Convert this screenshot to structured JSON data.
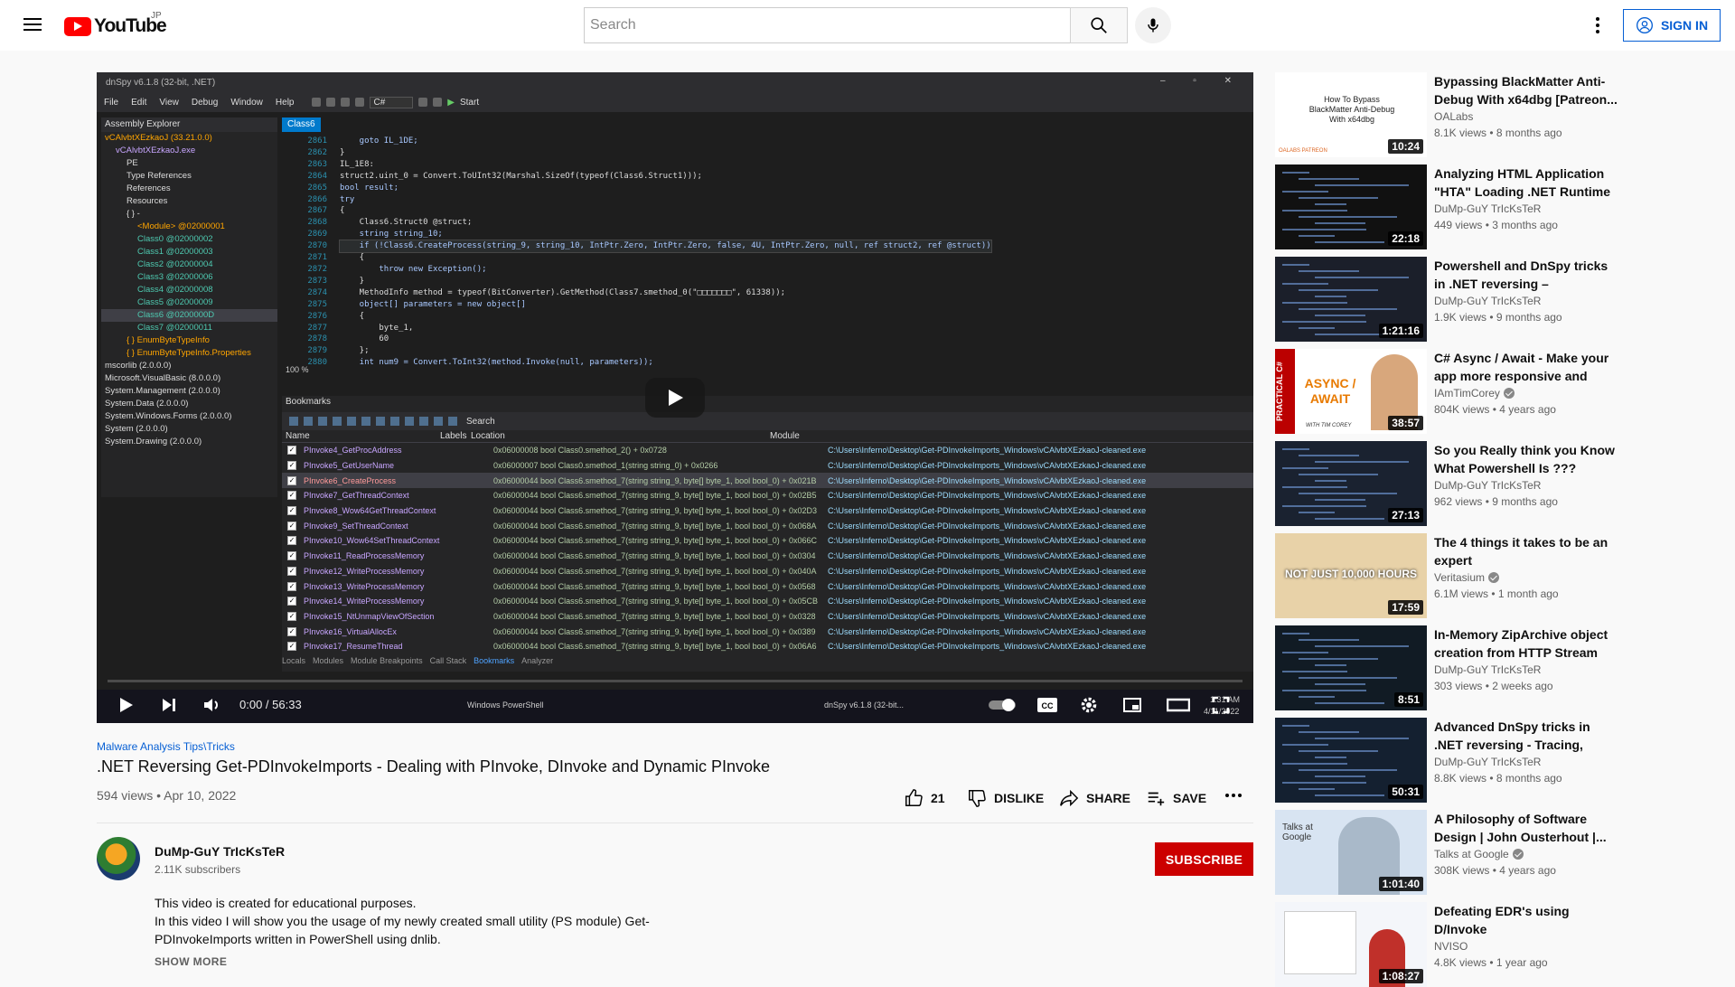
{
  "header": {
    "logo_text": "YouTube",
    "country_code": "JP",
    "search_placeholder": "Search",
    "signin_label": "SIGN IN"
  },
  "player": {
    "dnspy": {
      "window_title": "dnSpy v6.1.8 (32-bit, .NET)",
      "menu": [
        "File",
        "Edit",
        "View",
        "Debug",
        "Window",
        "Help"
      ],
      "language": "C#",
      "start_label": "Start",
      "assembly_explorer_title": "Assembly Explorer",
      "tree": [
        "vCAlvbtXEzkaoJ (33.21.0.0)",
        "vCAlvbtXEzkaoJ.exe",
        "PE",
        "Type References",
        "References",
        "Resources",
        "{ } -",
        "<Module> @02000001",
        "Class0 @02000002",
        "Class1 @02000003",
        "Class2 @02000004",
        "Class3 @02000006",
        "Class4 @02000008",
        "Class5 @02000009",
        "Class6 @0200000D",
        "Class7 @02000011",
        "{ } EnumByteTypeInfo",
        "{ } EnumByteTypeInfo.Properties",
        "mscorlib (2.0.0.0)",
        "Microsoft.VisualBasic (8.0.0.0)",
        "System.Management (2.0.0.0)",
        "System.Data (2.0.0.0)",
        "System.Windows.Forms (2.0.0.0)",
        "System (2.0.0.0)",
        "System.Drawing (2.0.0.0)"
      ],
      "code_tab": "Class6",
      "line_numbers": [
        "2861",
        "2862",
        "2863",
        "2864",
        "2865",
        "2866",
        "2867",
        "2868",
        "2869",
        "2870",
        "2871",
        "2872",
        "2873",
        "2874",
        "2875",
        "2876",
        "2877",
        "2878",
        "2879",
        "2880"
      ],
      "code_lines": [
        "    goto IL_1DE;",
        "}",
        "IL_1E8:",
        "struct2.uint_0 = Convert.ToUInt32(Marshal.SizeOf(typeof(Class6.Struct1)));",
        "bool result;",
        "try",
        "{",
        "    Class6.Struct0 @struct;",
        "    string string_10;",
        "    if (!Class6.CreateProcess(string_9, string_10, IntPtr.Zero, IntPtr.Zero, false, 4U, IntPtr.Zero, null, ref struct2, ref @struct))",
        "    {",
        "        throw new Exception();",
        "    }",
        "    MethodInfo method = typeof(BitConverter).GetMethod(Class7.smethod_0(\"□□□□□□□\", 61338));",
        "    object[] parameters = new object[]",
        "    {",
        "        byte_1,",
        "        60",
        "    };",
        "    int num9 = Convert.ToInt32(method.Invoke(null, parameters));"
      ],
      "zoom": "100 %",
      "bookmarks_title": "Bookmarks",
      "bookmarks_search": "Search",
      "bookmark_columns": [
        "Name",
        "Labels",
        "Location",
        "Module"
      ],
      "bookmarks": [
        {
          "name": "PInvoke4_GetProcAddress",
          "location": "0x06000008 bool Class0.smethod_2() + 0x0728"
        },
        {
          "name": "PInvoke5_GetUserName",
          "location": "0x06000007 bool Class0.smethod_1(string string_0) + 0x0266"
        },
        {
          "name": "PInvoke6_CreateProcess",
          "location": "0x06000044 bool Class6.smethod_7(string string_9, byte[] byte_1, bool bool_0) + 0x021B"
        },
        {
          "name": "PInvoke7_GetThreadContext",
          "location": "0x06000044 bool Class6.smethod_7(string string_9, byte[] byte_1, bool bool_0) + 0x02B5"
        },
        {
          "name": "PInvoke8_Wow64GetThreadContext",
          "location": "0x06000044 bool Class6.smethod_7(string string_9, byte[] byte_1, bool bool_0) + 0x02D3"
        },
        {
          "name": "PInvoke9_SetThreadContext",
          "location": "0x06000044 bool Class6.smethod_7(string string_9, byte[] byte_1, bool bool_0) + 0x068A"
        },
        {
          "name": "PInvoke10_Wow64SetThreadContext",
          "location": "0x06000044 bool Class6.smethod_7(string string_9, byte[] byte_1, bool bool_0) + 0x066C"
        },
        {
          "name": "PInvoke11_ReadProcessMemory",
          "location": "0x06000044 bool Class6.smethod_7(string string_9, byte[] byte_1, bool bool_0) + 0x0304"
        },
        {
          "name": "PInvoke12_WriteProcessMemory",
          "location": "0x06000044 bool Class6.smethod_7(string string_9, byte[] byte_1, bool bool_0) + 0x040A"
        },
        {
          "name": "PInvoke13_WriteProcessMemory",
          "location": "0x06000044 bool Class6.smethod_7(string string_9, byte[] byte_1, bool bool_0) + 0x0568"
        },
        {
          "name": "PInvoke14_WriteProcessMemory",
          "location": "0x06000044 bool Class6.smethod_7(string string_9, byte[] byte_1, bool bool_0) + 0x05CB"
        },
        {
          "name": "PInvoke15_NtUnmapViewOfSection",
          "location": "0x06000044 bool Class6.smethod_7(string string_9, byte[] byte_1, bool bool_0) + 0x0328"
        },
        {
          "name": "PInvoke16_VirtualAllocEx",
          "location": "0x06000044 bool Class6.smethod_7(string string_9, byte[] byte_1, bool bool_0) + 0x0389"
        },
        {
          "name": "PInvoke17_ResumeThread",
          "location": "0x06000044 bool Class6.smethod_7(string string_9, byte[] byte_1, bool bool_0) + 0x06A6"
        }
      ],
      "module_path": "C:\\Users\\Inferno\\Desktop\\Get-PDInvokeImports_Windows\\vCAlvbtXEzkaoJ-cleaned.exe",
      "bottom_tabs": [
        "Locals",
        "Modules",
        "Module Breakpoints",
        "Call Stack",
        "Bookmarks",
        "Analyzer"
      ],
      "taskbar_items": [
        "Windows PowerShell",
        "dnSpy v6.1.8 (32-bit..."
      ],
      "taskbar_time": "1:31 AM",
      "taskbar_date": "4/11/2022"
    },
    "time_display": "0:00 / 56:33"
  },
  "video": {
    "tags": "Malware Analysis Tips\\Tricks",
    "title": ".NET Reversing Get-PDInvokeImports - Dealing with PInvoke, DInvoke and Dynamic PInvoke",
    "info": "594 views • Apr 10, 2022",
    "likes": "21",
    "dislike_label": "DISLIKE",
    "share_label": "SHARE",
    "save_label": "SAVE"
  },
  "channel": {
    "name": "DuMp-GuY TrIcKsTeR",
    "subscribers": "2.11K subscribers",
    "subscribe_label": "SUBSCRIBE"
  },
  "description": {
    "line1": "This video is created for educational purposes.",
    "line2": "In this video I will show you the usage of my newly created small utility (PS module) Get-PDInvokeImports written in PowerShell using dnlib.",
    "show_more": "SHOW MORE"
  },
  "recommendations": [
    {
      "title": "Bypassing BlackMatter Anti-Debug With x64dbg [Patreon...",
      "channel": "OALabs",
      "verified": false,
      "meta": "8.1K views • 8 months ago",
      "duration": "10:24",
      "thumb_text": "How To Bypass BlackMatter Anti-Debug With x64dbg",
      "thumb_footer": "OALABS PATREON"
    },
    {
      "title": "Analyzing HTML Application \"HTA\" Loading .NET Runtime",
      "channel": "DuMp-GuY TrIcKsTeR",
      "verified": false,
      "meta": "449 views • 3 months ago",
      "duration": "22:18"
    },
    {
      "title": "Powershell and DnSpy tricks in .NET reversing – AgentTesla...",
      "channel": "DuMp-GuY TrIcKsTeR",
      "verified": false,
      "meta": "1.9K views • 9 months ago",
      "duration": "1:21:16"
    },
    {
      "title": "C# Async / Await - Make your app more responsive and fast...",
      "channel": "IAmTimCorey",
      "verified": true,
      "meta": "804K views • 4 years ago",
      "duration": "38:57",
      "thumb_side": "PRACTICAL C#",
      "thumb_text": "ASYNC / AWAIT",
      "thumb_footer": "WITH TIM COREY"
    },
    {
      "title": "So you Really think you Know What Powershell Is ???",
      "channel": "DuMp-GuY TrIcKsTeR",
      "verified": false,
      "meta": "962 views • 9 months ago",
      "duration": "27:13"
    },
    {
      "title": "The 4 things it takes to be an expert",
      "channel": "Veritasium",
      "verified": true,
      "meta": "6.1M views • 1 month ago",
      "duration": "17:59",
      "thumb_text": "NOT JUST 10,000 HOURS"
    },
    {
      "title": "In-Memory ZipArchive object creation from HTTP Stream",
      "channel": "DuMp-GuY TrIcKsTeR",
      "verified": false,
      "meta": "303 views • 2 weeks ago",
      "duration": "8:51"
    },
    {
      "title": "Advanced DnSpy tricks in .NET reversing - Tracing, Breaking,...",
      "channel": "DuMp-GuY TrIcKsTeR",
      "verified": false,
      "meta": "8.8K views • 8 months ago",
      "duration": "50:31"
    },
    {
      "title": "A Philosophy of Software Design | John Ousterhout |...",
      "channel": "Talks at Google",
      "verified": true,
      "meta": "308K views • 4 years ago",
      "duration": "1:01:40",
      "thumb_text": "Talks at Google"
    },
    {
      "title": "Defeating EDR's using D/Invoke",
      "channel": "NVISO",
      "verified": false,
      "meta": "4.8K views • 1 year ago",
      "duration": "1:08:27"
    }
  ],
  "colors": {
    "accent": "#065fd4",
    "subscribe": "#cc0000",
    "brand_red": "#ff0000"
  }
}
